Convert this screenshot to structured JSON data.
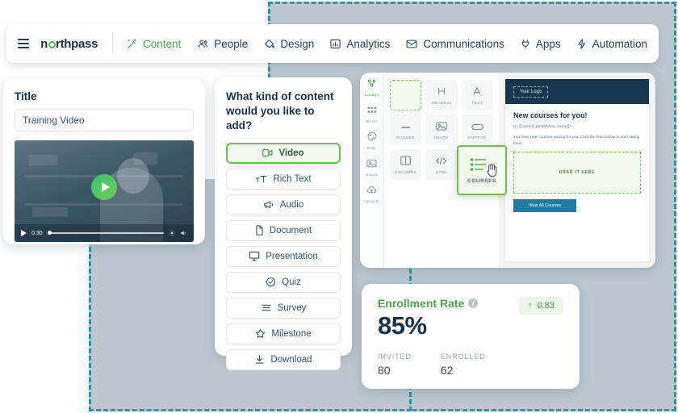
{
  "nav": {
    "brand": "n rthpass",
    "brand_pre": "n",
    "brand_post": "rthpass",
    "menu_icon": "hamburger-icon",
    "items": [
      {
        "label": "Content",
        "icon": "magic-wand-icon",
        "active": true
      },
      {
        "label": "People",
        "icon": "people-icon",
        "active": false
      },
      {
        "label": "Design",
        "icon": "paint-bucket-icon",
        "active": false
      },
      {
        "label": "Analytics",
        "icon": "bar-chart-icon",
        "active": false
      },
      {
        "label": "Communications",
        "icon": "envelope-icon",
        "active": false
      },
      {
        "label": "Apps",
        "icon": "plug-icon",
        "active": false
      },
      {
        "label": "Automation",
        "icon": "lightning-bolt-icon",
        "active": false
      }
    ]
  },
  "title_card": {
    "label": "Title",
    "input_value": "Training Video",
    "input_placeholder": "Title",
    "video": {
      "play_icon": "play-icon",
      "time": "0:30",
      "settings_icon": "gear-icon",
      "volume_icon": "speaker-icon"
    }
  },
  "picker": {
    "question_line1": "What kind of content",
    "question_line2": "would you like to add?",
    "options": [
      {
        "label": "Video",
        "icon": "video-camera-icon",
        "selected": true
      },
      {
        "label": "Rich Text",
        "icon": "text-format-icon",
        "selected": false
      },
      {
        "label": "Audio",
        "icon": "megaphone-icon",
        "selected": false
      },
      {
        "label": "Document",
        "icon": "document-icon",
        "selected": false
      },
      {
        "label": "Presentation",
        "icon": "presentation-screen-icon",
        "selected": false
      },
      {
        "label": "Quiz",
        "icon": "check-circle-icon",
        "selected": false
      },
      {
        "label": "Survey",
        "icon": "list-lines-icon",
        "selected": false
      },
      {
        "label": "Milestone",
        "icon": "star-icon",
        "selected": false
      },
      {
        "label": "Download",
        "icon": "download-arrow-icon",
        "selected": false
      }
    ]
  },
  "builder": {
    "sidebar": [
      {
        "label": "Content",
        "icon": "content-nodes-icon",
        "active": true
      },
      {
        "label": "Blocks",
        "icon": "grid-blocks-icon",
        "active": false
      },
      {
        "label": "Body",
        "icon": "palette-icon",
        "active": false
      },
      {
        "label": "Images",
        "icon": "image-icon",
        "active": false
      },
      {
        "label": "Uploads",
        "icon": "cloud-upload-icon",
        "active": false
      }
    ],
    "blocks": [
      {
        "label": "",
        "icon": "empty-drop-slot",
        "slot": true
      },
      {
        "label": "HEADING",
        "icon": "heading-h-icon",
        "slot": false
      },
      {
        "label": "TEXT",
        "icon": "text-a-icon",
        "slot": false
      },
      {
        "label": "DIVIDER",
        "icon": "divider-line-icon",
        "slot": false
      },
      {
        "label": "IMAGE",
        "icon": "image-icon",
        "slot": false
      },
      {
        "label": "BUTTON",
        "icon": "button-rect-icon",
        "slot": false
      },
      {
        "label": "COLUMNS",
        "icon": "columns-icon",
        "slot": false
      },
      {
        "label": "HTML",
        "icon": "code-brackets-icon",
        "slot": false
      },
      {
        "label": "",
        "icon": "hidden-block",
        "slot": false
      }
    ],
    "drag_chip": {
      "label": "COURSES",
      "icon": "courses-list-icon",
      "cursor": "grab-hand-cursor"
    },
    "email": {
      "logo_placeholder": "Your Logo",
      "heading": "New courses for you!",
      "greeting": "Hi, {{current_person.first_name}}!",
      "body": "You have new courses waiting for you. Click the links below to start taking them.",
      "dropzone_label": "DRAG IT HERE",
      "cta_label": "View All Courses"
    }
  },
  "enrollment": {
    "title": "Enrollment Rate",
    "info_icon": "info-icon",
    "badge": {
      "arrow": "↑",
      "value": "0.83"
    },
    "value": "85%",
    "stats": [
      {
        "key": "INVITED",
        "value": "80"
      },
      {
        "key": "ENROLLED",
        "value": "62"
      }
    ]
  },
  "colors": {
    "brand_green": "#4aa84a",
    "navy": "#16334a",
    "teal_dash": "#199aa8",
    "backdrop": "#bcc8ce",
    "email_header": "#15374f",
    "email_button": "#1b7e9e"
  }
}
